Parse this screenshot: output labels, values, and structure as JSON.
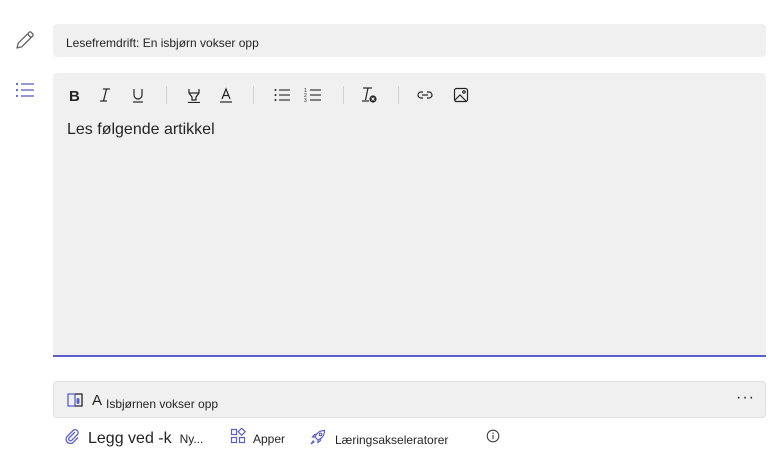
{
  "title_field": {
    "value": "Lesefremdrift: En isbjørn vokser opp"
  },
  "editor": {
    "content": "Les følgende artikkel",
    "toolbar": [
      "bold-icon",
      "italic-icon",
      "underline-icon",
      "highlight-icon",
      "font-color-icon",
      "bullet-list-icon",
      "numbered-list-icon",
      "clear-format-icon",
      "link-icon",
      "image-icon"
    ],
    "accent_color": "#5b5fc7"
  },
  "resource": {
    "letter": "A",
    "label": "Isbjørnen vokser opp",
    "more": "···"
  },
  "bottom_bar": {
    "attach_label": "Legg ved -k",
    "new_label": "Ny...",
    "apps_label": "Apper",
    "accelerators_label": "Læringsakseleratorer"
  }
}
